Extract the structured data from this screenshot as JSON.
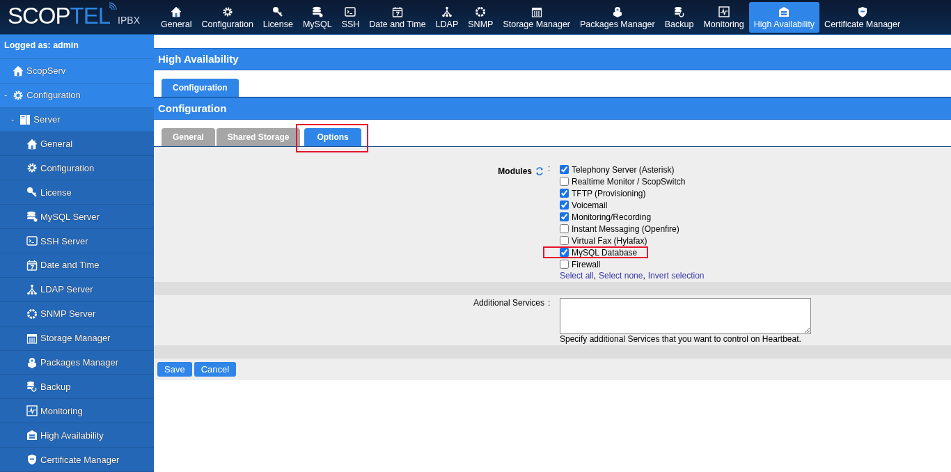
{
  "logo": {
    "main": "SCOP",
    "accent": "TEL",
    "suffix": "IPBX"
  },
  "nav": [
    {
      "label": "General",
      "selected": false
    },
    {
      "label": "Configuration",
      "selected": false
    },
    {
      "label": "License",
      "selected": false
    },
    {
      "label": "MySQL",
      "selected": false
    },
    {
      "label": "SSH",
      "selected": false
    },
    {
      "label": "Date and Time",
      "selected": false
    },
    {
      "label": "LDAP",
      "selected": false
    },
    {
      "label": "SNMP",
      "selected": false
    },
    {
      "label": "Storage Manager",
      "selected": false
    },
    {
      "label": "Packages Manager",
      "selected": false
    },
    {
      "label": "Backup",
      "selected": false
    },
    {
      "label": "Monitoring",
      "selected": false
    },
    {
      "label": "High Availability",
      "selected": true
    },
    {
      "label": "Certificate Manager",
      "selected": false
    }
  ],
  "sidebar": {
    "user": "Logged as: admin",
    "tree": [
      {
        "label": "ScopServ"
      },
      {
        "label": "Configuration",
        "toggle": "-",
        "expanded": true,
        "children": [
          {
            "label": "Server",
            "toggle": "-",
            "expanded": true,
            "children": [
              {
                "label": "General"
              },
              {
                "label": "Configuration"
              },
              {
                "label": "License"
              },
              {
                "label": "MySQL Server"
              },
              {
                "label": "SSH Server"
              },
              {
                "label": "Date and Time"
              },
              {
                "label": "LDAP Server"
              },
              {
                "label": "SNMP Server"
              },
              {
                "label": "Storage Manager"
              },
              {
                "label": "Packages Manager"
              },
              {
                "label": "Backup"
              },
              {
                "label": "Monitoring"
              },
              {
                "label": "High Availability"
              },
              {
                "label": "Certificate Manager"
              }
            ]
          }
        ]
      }
    ]
  },
  "page_title": "High Availability",
  "tabs": [
    {
      "label": "Configuration",
      "selected": true
    }
  ],
  "section_title": "Configuration",
  "subtabs": [
    {
      "label": "General",
      "selected": false,
      "highlighted": false
    },
    {
      "label": "Shared Storage",
      "selected": false,
      "highlighted": false
    },
    {
      "label": "Options",
      "selected": true,
      "highlighted": true
    }
  ],
  "form": {
    "modules_label": "Modules",
    "colon": ":",
    "modules": [
      {
        "label": "Telephony Server (Asterisk)",
        "checked": true,
        "highlighted": false
      },
      {
        "label": "Realtime Monitor / ScopSwitch",
        "checked": false,
        "highlighted": false
      },
      {
        "label": "TFTP (Provisioning)",
        "checked": true,
        "highlighted": false
      },
      {
        "label": "Voicemail",
        "checked": true,
        "highlighted": false
      },
      {
        "label": "Monitoring/Recording",
        "checked": true,
        "highlighted": false
      },
      {
        "label": "Instant Messaging (Openfire)",
        "checked": false,
        "highlighted": false
      },
      {
        "label": "Virtual Fax (Hylafax)",
        "checked": false,
        "highlighted": false
      },
      {
        "label": "MySQL Database",
        "checked": true,
        "highlighted": true
      },
      {
        "label": "Firewall",
        "checked": false,
        "highlighted": false
      }
    ],
    "selection_links": [
      "Select all",
      "Select none",
      "Invert selection"
    ],
    "services_label": "Additional Services",
    "link_separator": ",",
    "services_hint": "Specify additional Services that you want to control on Heartbeat."
  },
  "buttons": [
    "Save",
    "Cancel"
  ]
}
